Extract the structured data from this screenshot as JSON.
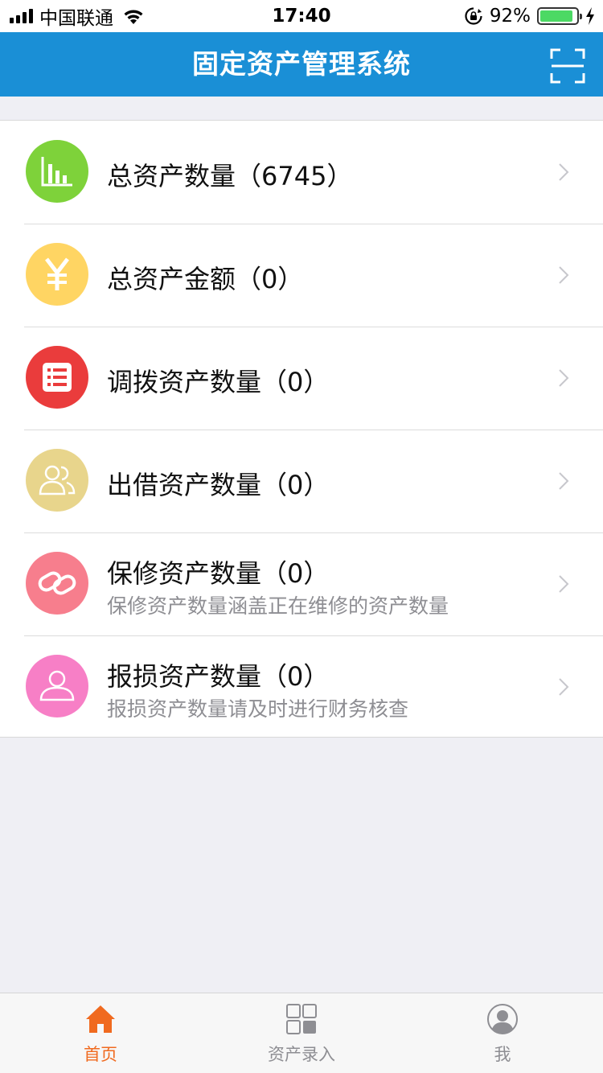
{
  "status_bar": {
    "carrier": "中国联通",
    "time": "17:40",
    "battery_percent": "92%",
    "battery_level": 0.92
  },
  "nav": {
    "title": "固定资产管理系统",
    "scan_icon": "scan-icon"
  },
  "items": [
    {
      "title": "总资产数量（6745）",
      "subtitle": "",
      "icon": "bar-chart-icon",
      "color": "#7ed23a"
    },
    {
      "title": "总资产金额（0）",
      "subtitle": "",
      "icon": "yuan-icon",
      "color": "#ffd563"
    },
    {
      "title": "调拨资产数量（0）",
      "subtitle": "",
      "icon": "list-icon",
      "color": "#ea3c3c"
    },
    {
      "title": "出借资产数量（0）",
      "subtitle": "",
      "icon": "users-icon",
      "color": "#e8d58c"
    },
    {
      "title": "保修资产数量（0）",
      "subtitle": "保修资产数量涵盖正在维修的资产数量",
      "icon": "link-icon",
      "color": "#f77e8d"
    },
    {
      "title": "报损资产数量（0）",
      "subtitle": "报损资产数量请及时进行财务核查",
      "icon": "user-icon",
      "color": "#f77fc6"
    }
  ],
  "tabs": [
    {
      "label": "首页",
      "icon": "home-icon",
      "active": true
    },
    {
      "label": "资产录入",
      "icon": "grid-icon",
      "active": false
    },
    {
      "label": "我",
      "icon": "profile-icon",
      "active": false
    }
  ],
  "colors": {
    "nav_blue": "#1a8fd6",
    "tab_active": "#f06a1f",
    "tab_inactive": "#8e8e93",
    "background": "#efeff4"
  }
}
